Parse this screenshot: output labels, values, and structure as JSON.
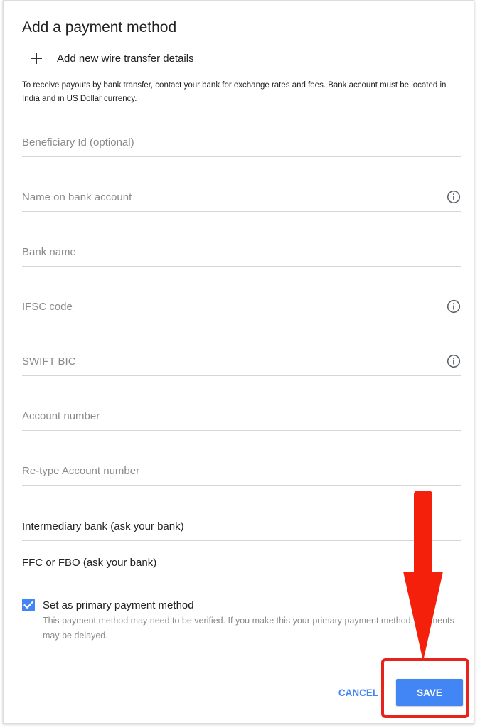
{
  "dialog": {
    "title": "Add a payment method",
    "add_wire_label": "Add new wire transfer details",
    "info_text": "To receive payouts by bank transfer, contact your bank for exchange rates and fees. Bank account must be located in India and in US Dollar currency."
  },
  "fields": {
    "beneficiary_id": {
      "placeholder": "Beneficiary Id (optional)",
      "value": ""
    },
    "name_on_account": {
      "placeholder": "Name on bank account",
      "value": ""
    },
    "bank_name": {
      "placeholder": "Bank name",
      "value": ""
    },
    "ifsc_code": {
      "placeholder": "IFSC code",
      "value": ""
    },
    "swift_bic": {
      "placeholder": "SWIFT BIC",
      "value": ""
    },
    "account_number": {
      "placeholder": "Account number",
      "value": ""
    },
    "retype_account_number": {
      "placeholder": "Re-type Account number",
      "value": ""
    },
    "intermediary_bank": {
      "placeholder": "Intermediary bank (ask your bank)",
      "value": ""
    },
    "ffc_fbo": {
      "placeholder": "FFC or FBO (ask your bank)",
      "value": ""
    }
  },
  "primary": {
    "checked": true,
    "label": "Set as primary payment method",
    "help": "This payment method may need to be verified. If you make this your primary payment method, payments may be delayed."
  },
  "actions": {
    "cancel_label": "CANCEL",
    "save_label": "SAVE"
  },
  "colors": {
    "accent": "#4285f4",
    "annotation": "#e8231b"
  },
  "icons": {
    "add": "plus-icon",
    "info": "info-icon",
    "checkbox": "checkmark-icon",
    "annotation": "arrow-down-icon"
  }
}
